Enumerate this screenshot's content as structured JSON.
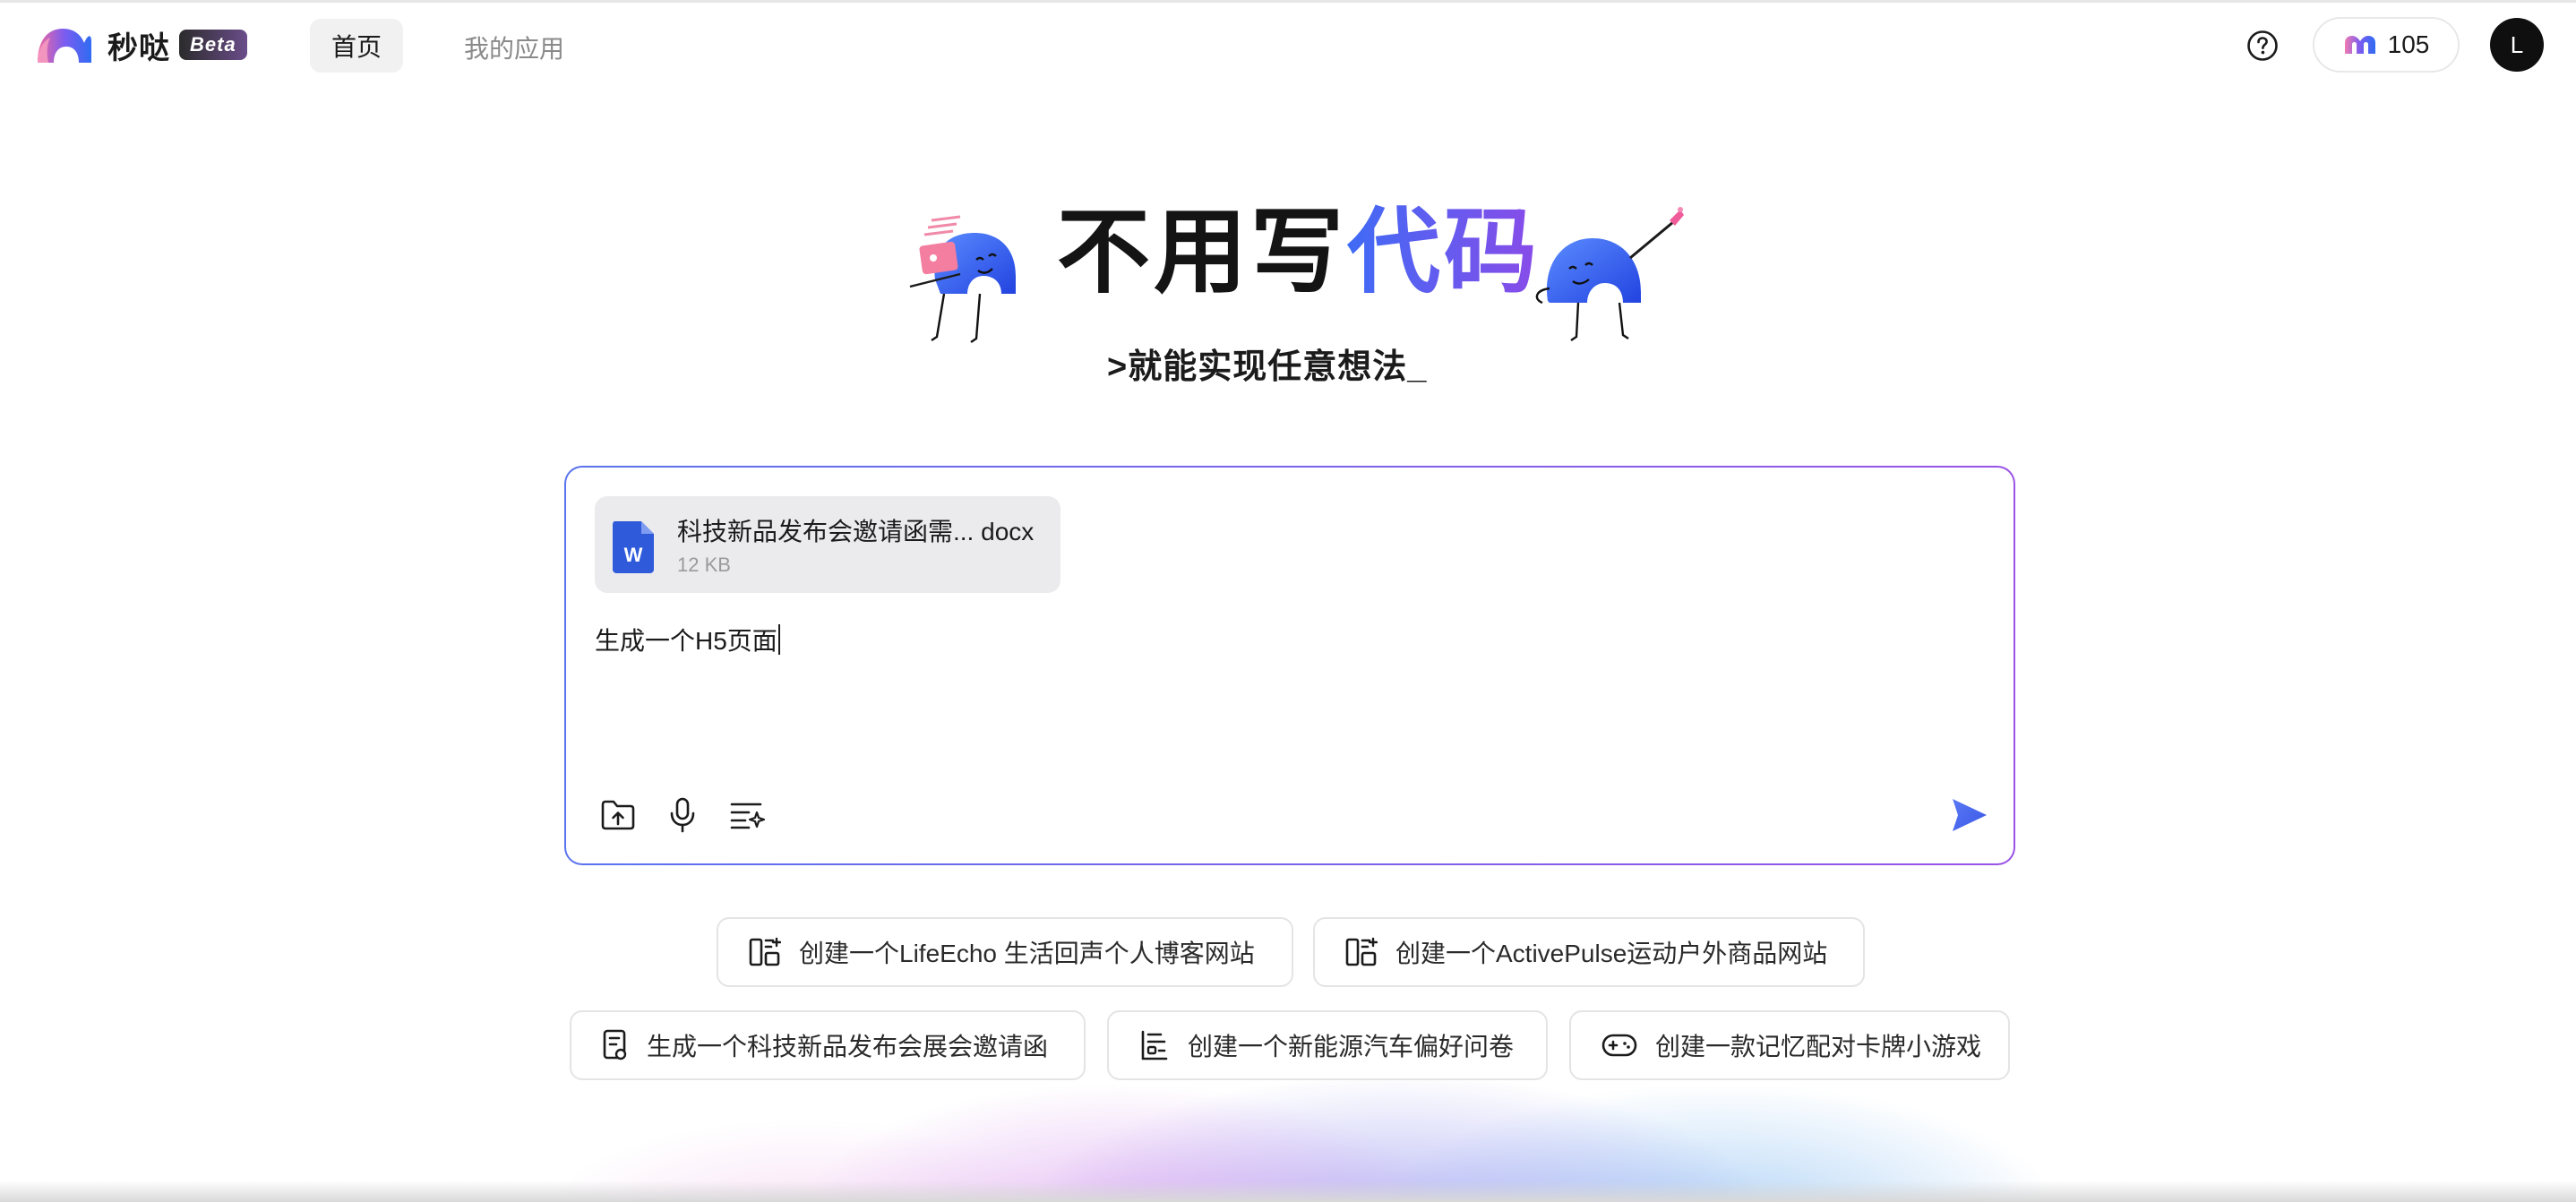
{
  "header": {
    "brand": "秒哒",
    "badge": "Beta",
    "nav": [
      {
        "label": "首页"
      },
      {
        "label": "我的应用"
      }
    ],
    "credits": "105",
    "avatar_letter": "L"
  },
  "hero": {
    "title_black": "不用写",
    "title_accent": "代码",
    "subtitle": ">就能实现任意想法_"
  },
  "composer": {
    "attachment": {
      "name": "科技新品发布会邀请函需... docx",
      "size": "12 KB",
      "icon_letter": "W"
    },
    "text": "生成一个H5页面",
    "tools": [
      "folder-upload-icon",
      "microphone-icon",
      "prompt-list-icon"
    ],
    "send_icon": "send-icon"
  },
  "suggestions": [
    {
      "label": "创建一个LifeEcho 生活回声个人博客网站",
      "icon": "layout-icon"
    },
    {
      "label": "创建一个ActivePulse运动户外商品网站",
      "icon": "layout-icon"
    },
    {
      "label": "生成一个科技新品发布会展会邀请函",
      "icon": "document-icon"
    },
    {
      "label": "创建一个新能源汽车偏好问卷",
      "icon": "survey-icon"
    },
    {
      "label": "创建一款记忆配对卡牌小游戏",
      "icon": "gamepad-icon"
    }
  ],
  "colors": {
    "accent_blue": "#3f6bf5",
    "accent_purple": "#8a4be8",
    "word_blue": "#2f5bdb"
  }
}
